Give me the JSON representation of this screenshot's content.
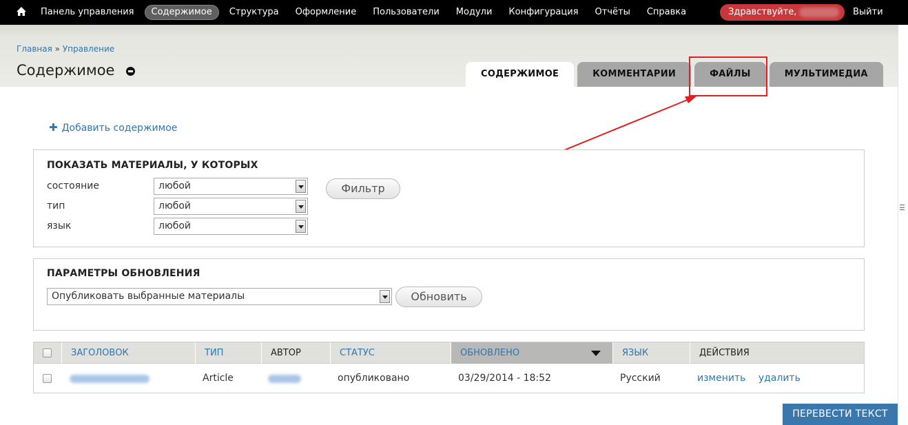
{
  "toolbar": {
    "home_icon": "home-icon",
    "menu": [
      {
        "label": "Панель управления",
        "active": false
      },
      {
        "label": "Содержимое",
        "active": true
      },
      {
        "label": "Структура",
        "active": false
      },
      {
        "label": "Оформление",
        "active": false
      },
      {
        "label": "Пользователи",
        "active": false
      },
      {
        "label": "Модули",
        "active": false
      },
      {
        "label": "Конфигурация",
        "active": false
      },
      {
        "label": "Отчёты",
        "active": false
      },
      {
        "label": "Справка",
        "active": false
      }
    ],
    "greeting": "Здравствуйте,",
    "logout": "Выйти",
    "greeting_color": "#c8383a"
  },
  "breadcrumb": {
    "home": "Главная",
    "separator": "»",
    "current": "Управление"
  },
  "page_title": "Содержимое",
  "tabs": [
    {
      "label": "СОДЕРЖИМОЕ",
      "active": true
    },
    {
      "label": "КОММЕНТАРИИ",
      "active": false
    },
    {
      "label": "ФАЙЛЫ",
      "active": false
    },
    {
      "label": "МУЛЬТИМЕДИА",
      "active": false
    }
  ],
  "add_content": "Добавить содержимое",
  "filter": {
    "legend": "ПОКАЗАТЬ МАТЕРИАЛЫ, У КОТОРЫХ",
    "fields": [
      {
        "label": "состояние",
        "value": "любой"
      },
      {
        "label": "тип",
        "value": "любой"
      },
      {
        "label": "язык",
        "value": "любой"
      }
    ],
    "button": "Фильтр"
  },
  "update": {
    "legend": "ПАРАМЕТРЫ ОБНОВЛЕНИЯ",
    "action": "Опубликовать выбранные материалы",
    "button": "Обновить"
  },
  "table": {
    "headers": {
      "title": "ЗАГОЛОВОК",
      "type": "ТИП",
      "author": "АВТОР",
      "status": "СТАТУС",
      "updated": "ОБНОВЛЕНО",
      "language": "ЯЗЫК",
      "actions": "ДЕЙСТВИЯ"
    },
    "rows": [
      {
        "type": "Article",
        "status": "опубликовано",
        "updated": "03/29/2014 - 18:52",
        "language": "Русский",
        "edit": "изменить",
        "delete": "удалить"
      }
    ]
  },
  "translate_button": "ПЕРЕВЕСТИ ТЕКСТ",
  "colors": {
    "link": "#2e76ae",
    "annotation": "#e02020",
    "translate": "#3a77ad"
  }
}
